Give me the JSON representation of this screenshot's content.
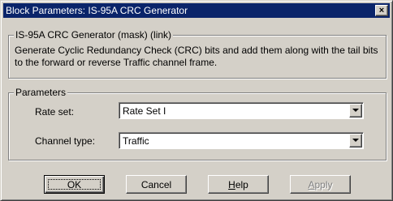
{
  "window": {
    "title": "Block Parameters: IS-95A CRC Generator",
    "close_glyph": "×"
  },
  "mask_group": {
    "legend": "IS-95A CRC Generator (mask) (link)",
    "description": "Generate Cyclic Redundancy Check (CRC) bits and add them along with the tail bits to the forward or reverse Traffic channel frame."
  },
  "parameters": {
    "legend": "Parameters",
    "rate_set": {
      "label": "Rate set:",
      "value": "Rate Set I"
    },
    "channel_type": {
      "label": "Channel type:",
      "value": "Traffic"
    }
  },
  "buttons": {
    "ok": {
      "label": "OK"
    },
    "cancel": {
      "label": "Cancel"
    },
    "help": {
      "first": "H",
      "rest": "elp"
    },
    "apply": {
      "first": "A",
      "rest": "pply",
      "disabled": true
    }
  },
  "colors": {
    "titlebar": "#0a246a",
    "face": "#d4d0c8",
    "field": "#ffffff",
    "disabled_text": "#808080"
  },
  "icons": {
    "close": "close-icon",
    "dropdown": "chevron-down-icon"
  }
}
